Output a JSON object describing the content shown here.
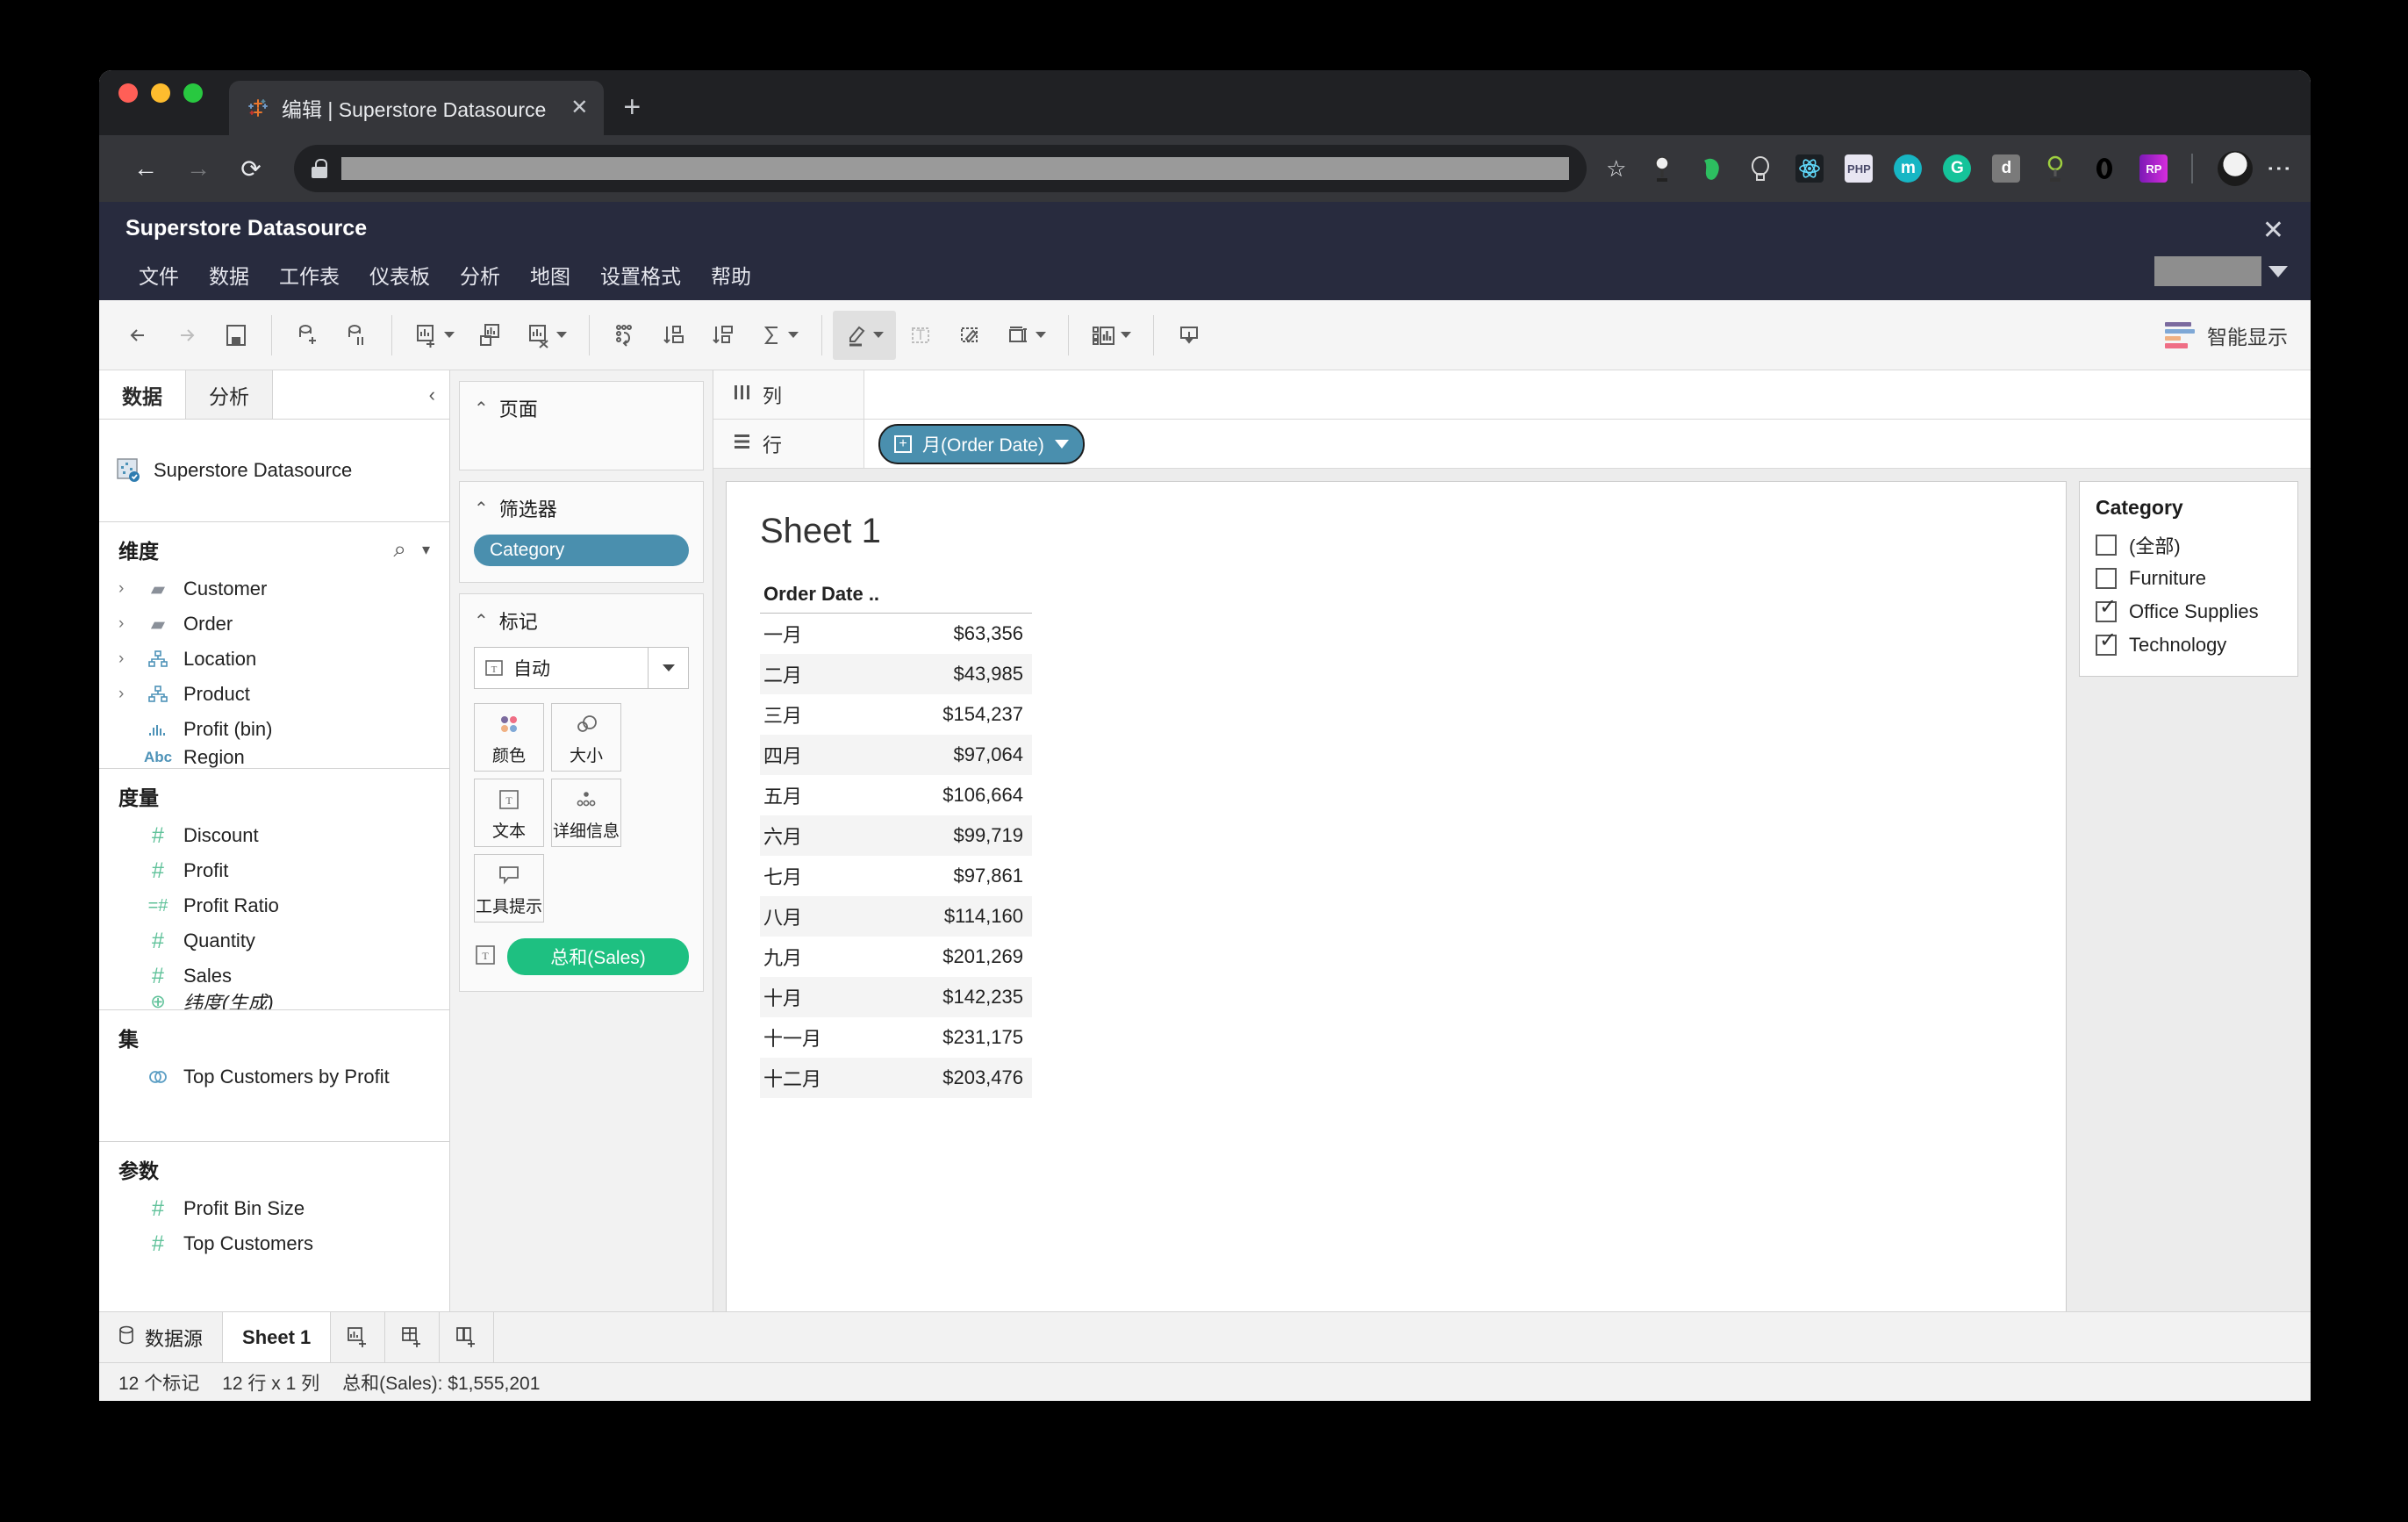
{
  "browser": {
    "tab_title": "编辑 | Superstore Datasource",
    "tab_close": "✕",
    "new_tab": "+",
    "back_icon": "←",
    "forward_icon": "→",
    "reload_icon": "⟳",
    "star_icon": "☆",
    "kebab_icon": "⋮",
    "extensions": [
      {
        "name": "lamp-extension-icon",
        "glyph": "",
        "color": "#3a3a3a"
      },
      {
        "name": "evernote-extension-icon",
        "glyph": "",
        "color": "#2dbe60"
      },
      {
        "name": "lightbulb-extension-icon",
        "glyph": "",
        "color": "#cfcfcf"
      },
      {
        "name": "react-extension-icon",
        "glyph": "",
        "color": "#1b1f23"
      },
      {
        "name": "php-extension-icon",
        "glyph": "PHP",
        "color": "#e8e6f2"
      },
      {
        "name": "momentum-extension-icon",
        "glyph": "m",
        "color": "#17b6c4"
      },
      {
        "name": "grammarly-extension-icon",
        "glyph": "G",
        "color": "#15c39a"
      },
      {
        "name": "d-extension-icon",
        "glyph": "d",
        "color": "#7a7a7a"
      },
      {
        "name": "magnifier-extension-icon",
        "glyph": "",
        "color": "#9ecf3f"
      },
      {
        "name": "opera-extension-icon",
        "glyph": "O",
        "color": "#000000"
      },
      {
        "name": "rp-extension-icon",
        "glyph": "RP",
        "color": "#b026d1"
      }
    ]
  },
  "app": {
    "datasource_title": "Superstore Datasource",
    "close_icon": "✕",
    "menu": [
      "文件",
      "数据",
      "工作表",
      "仪表板",
      "分析",
      "地图",
      "设置格式",
      "帮助"
    ],
    "showme_label": "智能显示",
    "showme_bar_colors": [
      "#7b6a9e",
      "#7fa8d6",
      "#f0b183",
      "#ef6e85"
    ]
  },
  "data_pane": {
    "tabs": [
      {
        "label": "数据",
        "selected": true
      },
      {
        "label": "分析",
        "selected": false
      }
    ],
    "collapse_icon": "‹",
    "datasource": "Superstore Datasource",
    "dimensions": {
      "title": "维度",
      "search_icon": "⌕",
      "menu_icon": "▾",
      "items": [
        {
          "label": "Customer",
          "icon": "folder",
          "expandable": true
        },
        {
          "label": "Order",
          "icon": "folder",
          "expandable": true
        },
        {
          "label": "Location",
          "icon": "hier",
          "expandable": true
        },
        {
          "label": "Product",
          "icon": "hier",
          "expandable": true
        },
        {
          "label": "Profit (bin)",
          "icon": "bin",
          "expandable": false
        },
        {
          "label": "Region",
          "icon": "abc",
          "expandable": false
        }
      ]
    },
    "measures": {
      "title": "度量",
      "items": [
        {
          "label": "Discount",
          "icon": "num"
        },
        {
          "label": "Profit",
          "icon": "num"
        },
        {
          "label": "Profit Ratio",
          "icon": "calc"
        },
        {
          "label": "Quantity",
          "icon": "num"
        },
        {
          "label": "Sales",
          "icon": "num"
        },
        {
          "label": "纬度(生成)",
          "icon": "geo",
          "italic": true
        }
      ]
    },
    "sets": {
      "title": "集",
      "items": [
        {
          "label": "Top Customers by Profit",
          "icon": "set"
        }
      ]
    },
    "parameters": {
      "title": "参数",
      "items": [
        {
          "label": "Profit Bin Size",
          "icon": "num"
        },
        {
          "label": "Top Customers",
          "icon": "num"
        }
      ]
    }
  },
  "cards": {
    "pages": {
      "title": "页面"
    },
    "filters": {
      "title": "筛选器",
      "pills": [
        "Category"
      ]
    },
    "marks": {
      "title": "标记",
      "mark_type": "自动",
      "buttons": [
        {
          "label": "颜色",
          "icon": "color-icon"
        },
        {
          "label": "大小",
          "icon": "size-icon"
        },
        {
          "label": "文本",
          "icon": "text-icon"
        },
        {
          "label": "详细信息",
          "icon": "detail-icon"
        },
        {
          "label": "工具提示",
          "icon": "tooltip-icon"
        }
      ],
      "pill": "总和(Sales)"
    }
  },
  "shelves": {
    "columns_label": "列",
    "columns_pills": [],
    "rows_label": "行",
    "rows_pills": [
      "月(Order Date)"
    ]
  },
  "sheet": {
    "title": "Sheet 1",
    "column_header": "Order Date ..",
    "rows": [
      {
        "month": "一月",
        "value": "$63,356"
      },
      {
        "month": "二月",
        "value": "$43,985"
      },
      {
        "month": "三月",
        "value": "$154,237"
      },
      {
        "month": "四月",
        "value": "$97,064"
      },
      {
        "month": "五月",
        "value": "$106,664"
      },
      {
        "month": "六月",
        "value": "$99,719"
      },
      {
        "month": "七月",
        "value": "$97,861"
      },
      {
        "month": "八月",
        "value": "$114,160"
      },
      {
        "month": "九月",
        "value": "$201,269"
      },
      {
        "month": "十月",
        "value": "$142,235"
      },
      {
        "month": "十一月",
        "value": "$231,175"
      },
      {
        "month": "十二月",
        "value": "$203,476"
      }
    ]
  },
  "legend": {
    "title": "Category",
    "items": [
      {
        "label": "(全部)",
        "checked": false
      },
      {
        "label": "Furniture",
        "checked": false
      },
      {
        "label": "Office Supplies",
        "checked": true
      },
      {
        "label": "Technology",
        "checked": true
      }
    ]
  },
  "bottom": {
    "datasource_tab": "数据源",
    "sheet_tabs": [
      {
        "label": "Sheet 1",
        "active": true
      }
    ],
    "status": [
      "12 个标记",
      "12 行 x 1 列",
      "总和(Sales): $1,555,201"
    ]
  },
  "chart_data": {
    "type": "table",
    "title": "Sheet 1",
    "xlabel": "Order Date ..",
    "ylabel": "总和(Sales)",
    "categories": [
      "一月",
      "二月",
      "三月",
      "四月",
      "五月",
      "六月",
      "七月",
      "八月",
      "九月",
      "十月",
      "十一月",
      "十二月"
    ],
    "values": [
      63356,
      43985,
      154237,
      97064,
      106664,
      99719,
      97861,
      114160,
      201269,
      142235,
      231175,
      203476
    ],
    "total": 1555201,
    "filters": {
      "Category": [
        "Office Supplies",
        "Technology"
      ]
    }
  }
}
